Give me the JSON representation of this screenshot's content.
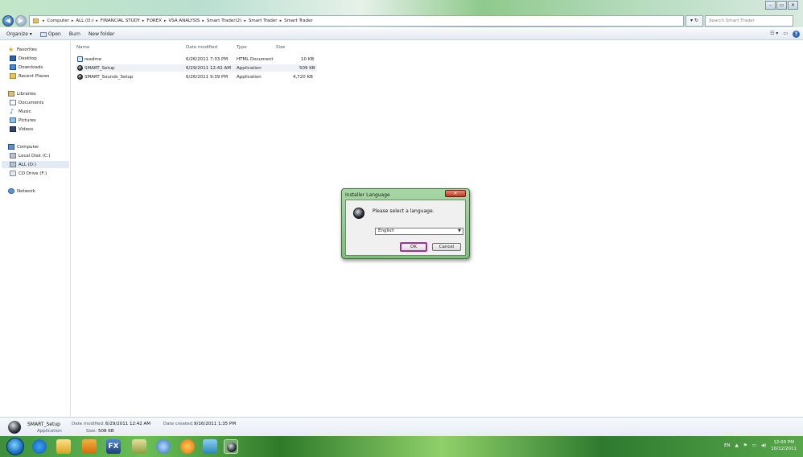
{
  "addressbar": {
    "crumbs": [
      "Computer",
      "ALL (D:)",
      "FINANCIAL STUDY",
      "FOREX",
      "VSA ANALYSIS",
      "Smart Trader(2)",
      "Smart Trader",
      "Smart Trader"
    ],
    "search_placeholder": "Search Smart Trader"
  },
  "toolbar": {
    "organize": "Organize ▾",
    "open": "Open",
    "burn": "Burn",
    "new_folder": "New folder"
  },
  "navpane": {
    "favorites": "Favorites",
    "desktop": "Desktop",
    "downloads": "Downloads",
    "recent_places": "Recent Places",
    "libraries": "Libraries",
    "documents": "Documents",
    "music": "Music",
    "pictures": "Pictures",
    "videos": "Videos",
    "computer": "Computer",
    "local_disk": "Local Disk (C:)",
    "all_d": "ALL (D:)",
    "cd_drive": "CD Drive (F:)",
    "network": "Network"
  },
  "filelist": {
    "columns": {
      "name": "Name",
      "date": "Date modified",
      "type": "Type",
      "size": "Size"
    },
    "rows": [
      {
        "name": "readme",
        "date": "6/26/2011 7:33 PM",
        "type": "HTML Document",
        "size": "10 KB"
      },
      {
        "name": "SMART_Setup",
        "date": "6/29/2011 12:42 AM",
        "type": "Application",
        "size": "509 KB"
      },
      {
        "name": "SMART_Sounds_Setup",
        "date": "6/26/2011 9:39 PM",
        "type": "Application",
        "size": "4,720 KB"
      }
    ]
  },
  "dialog": {
    "title": "Installer Language",
    "prompt": "Please select a language.",
    "selected_language": "English",
    "ok": "OK",
    "cancel": "Cancel"
  },
  "details": {
    "name": "SMART_Setup",
    "type": "Application",
    "date_modified_label": "Date modified:",
    "date_modified": "6/29/2011 12:42 AM",
    "size_label": "Size:",
    "size": "508 KB",
    "date_created_label": "Date created:",
    "date_created": "9/16/2011 1:35 PM"
  },
  "taskbar": {
    "fx_label": "FX",
    "lang": "EN",
    "time": "12:00 PM",
    "date": "10/12/2011"
  },
  "colors": {
    "taskbar_green": "#3b8f3b",
    "dialog_frame": "#8fc98c",
    "ok_focus": "#a0309c"
  }
}
